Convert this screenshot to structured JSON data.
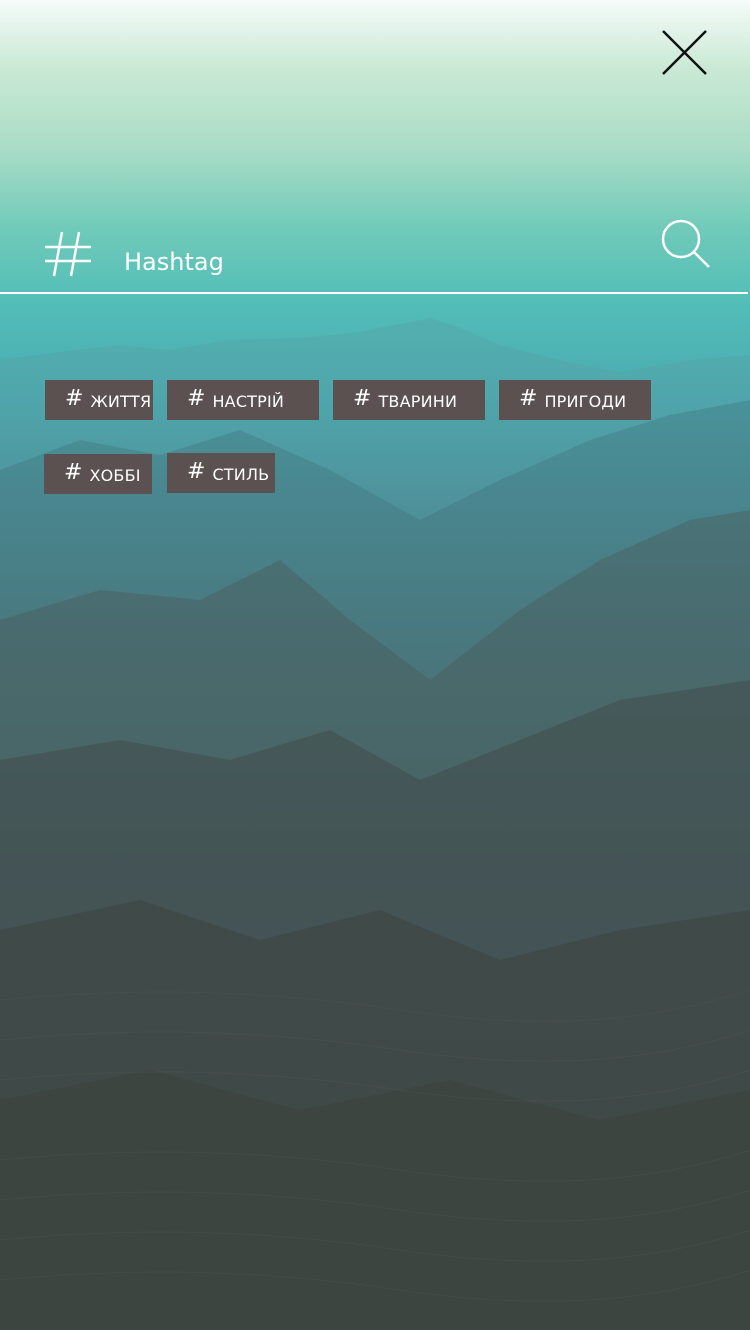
{
  "search": {
    "placeholder": "Hashtag",
    "value": ""
  },
  "icons": {
    "close": "close-icon",
    "hashtag": "hashtag-icon",
    "search": "search-icon"
  },
  "tags": [
    {
      "symbol": "#",
      "label": "ЖИТТЯ"
    },
    {
      "symbol": "#",
      "label": "НАСТРІЙ"
    },
    {
      "symbol": "#",
      "label": "ТВАРИНИ"
    },
    {
      "symbol": "#",
      "label": "ПРИГОДИ"
    },
    {
      "symbol": "#",
      "label": "ХОББІ"
    },
    {
      "symbol": "#",
      "label": "СТИЛЬ"
    }
  ],
  "colors": {
    "tag_background": "#5b5151",
    "text": "#ffffff",
    "close_icon": "#111111"
  }
}
